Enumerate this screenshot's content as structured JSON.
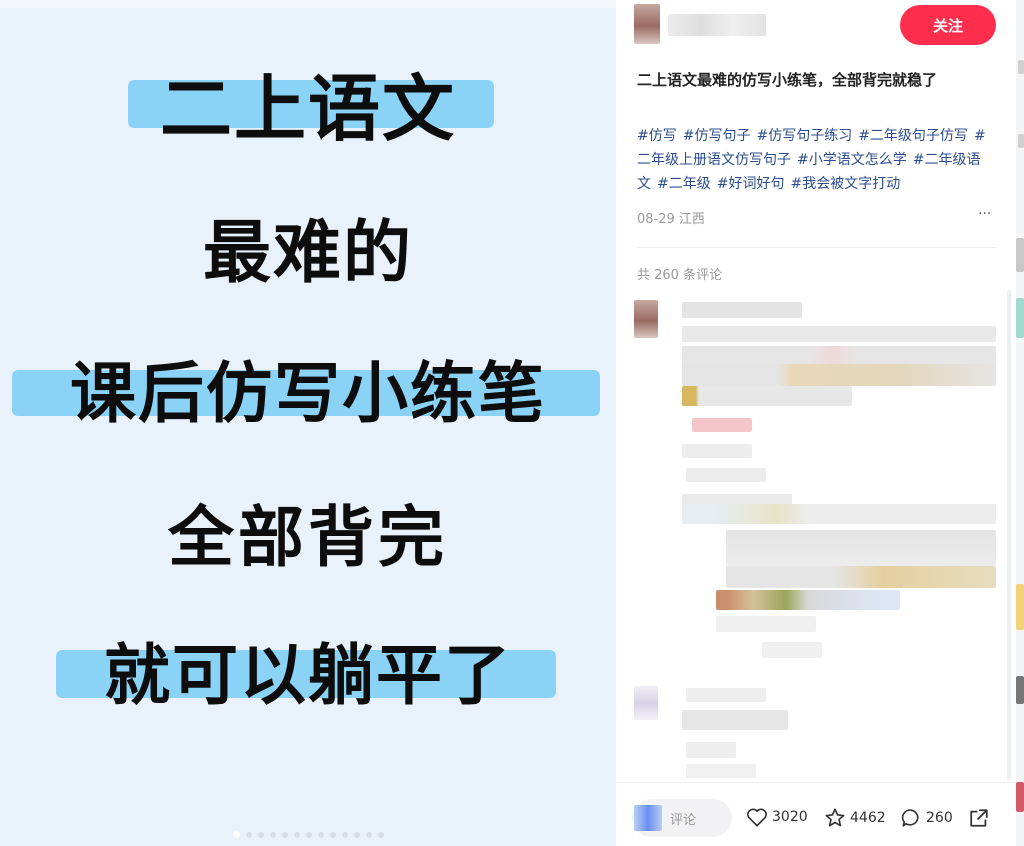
{
  "cover": {
    "lines": [
      "二上语文",
      "最难的",
      "课后仿写小练笔",
      "全部背完",
      "就可以躺平了"
    ],
    "highlight_color": "#8bd3f6",
    "background_color": "#e9f1fb",
    "slide_count": 13,
    "active_slide": 1
  },
  "author": {
    "follow_label": "关注"
  },
  "note": {
    "title": "二上语文最难的仿写小练笔，全部背完就稳了",
    "tags": [
      "#仿写",
      "#仿写句子",
      "#仿写句子练习",
      "#二年级句子仿写",
      "#二年级上册语文仿写句子",
      "#小学语文怎么学",
      "#二年级语文",
      "#二年级",
      "#好词好句",
      "#我会被文字打动"
    ],
    "date_location": "08-29 江西",
    "more_icon": "ellipsis-icon"
  },
  "comments": {
    "count_label": "共 260 条评论"
  },
  "footer": {
    "comment_placeholder": "评论",
    "likes": "3020",
    "collects": "4462",
    "comments": "260",
    "icons": [
      "heart-icon",
      "star-icon",
      "comment-bubble-icon",
      "share-icon"
    ]
  },
  "colors": {
    "accent": "#ff2e4d",
    "tag": "#2b4d8f"
  }
}
